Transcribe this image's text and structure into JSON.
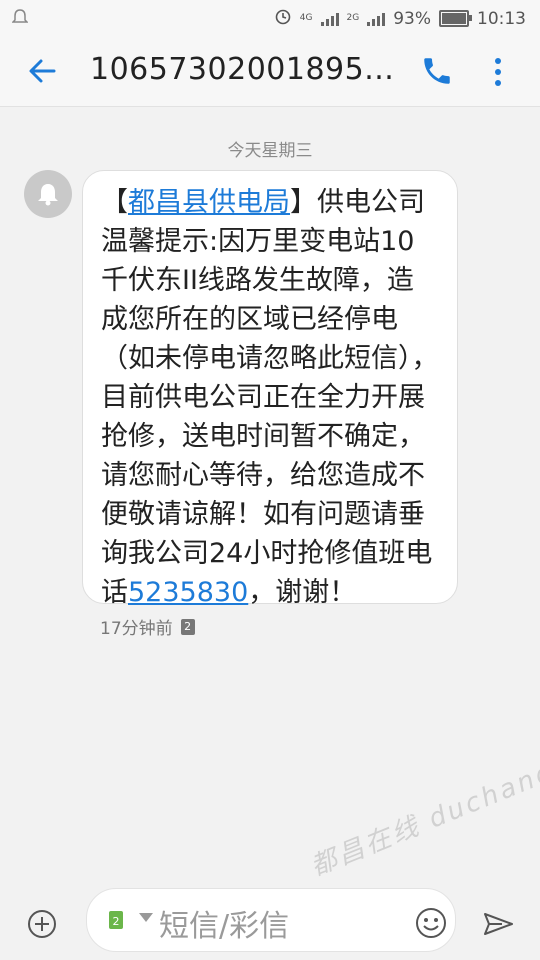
{
  "status_bar": {
    "network_1": "4G",
    "network_2": "2G",
    "battery_text": "93%",
    "battery_level": 0.93,
    "time": "10:13"
  },
  "header": {
    "title": "10657302001895...",
    "icons": {
      "back": "back-arrow-icon",
      "call": "phone-icon",
      "more": "more-vert-icon"
    }
  },
  "conversation": {
    "date_label": "今天星期三",
    "message": {
      "bracket_open": "【",
      "sender_link": "都昌县供电局",
      "text_part1": "】供电公司温馨提示:因万里变电站10千伏东II线路发生故障，造成您所在的区域已经停电（如未停电请忽略此短信），目前供电公司正在全力开展抢修，送电时间暂不确定，请您耐心等待，给您造成不便敬请谅解！如有问题请垂询我公司24小时抢修值班电话",
      "phone_link": "5235830",
      "text_part2": "，谢谢！"
    },
    "time_ago": "17分钟前",
    "sim_slot": "2"
  },
  "composer": {
    "placeholder": "短信/彩信",
    "sim_badge": "2",
    "icons": {
      "add": "plus-circle-icon",
      "emoji": "emoji-icon",
      "send": "send-icon"
    }
  },
  "watermark": "都昌在线 duchang.cc",
  "colors": {
    "accent": "#1d7bd8",
    "background": "#f2f2f2",
    "bubble": "#ffffff"
  }
}
